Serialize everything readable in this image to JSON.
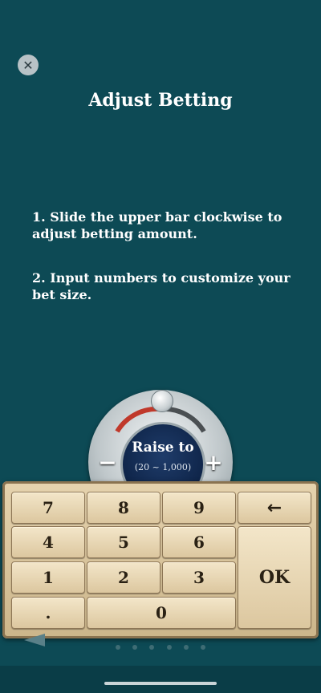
{
  "close": {
    "icon": "close-icon",
    "glyph": "✕"
  },
  "title": "Adjust Betting",
  "instructions": [
    "1. Slide the upper bar clockwise to adjust betting amount.",
    "2. Input numbers to customize your bet size."
  ],
  "dial": {
    "label": "Raise to",
    "range": "(20 ~ 1,000)",
    "minus": "−",
    "plus": "+"
  },
  "keypad": {
    "row1": [
      "7",
      "8",
      "9"
    ],
    "row2": [
      "4",
      "5",
      "6"
    ],
    "row3": [
      "1",
      "2",
      "3"
    ],
    "dot": ".",
    "zero": "0",
    "backspace": "←",
    "ok": "OK"
  },
  "pager": {
    "count": 6
  }
}
